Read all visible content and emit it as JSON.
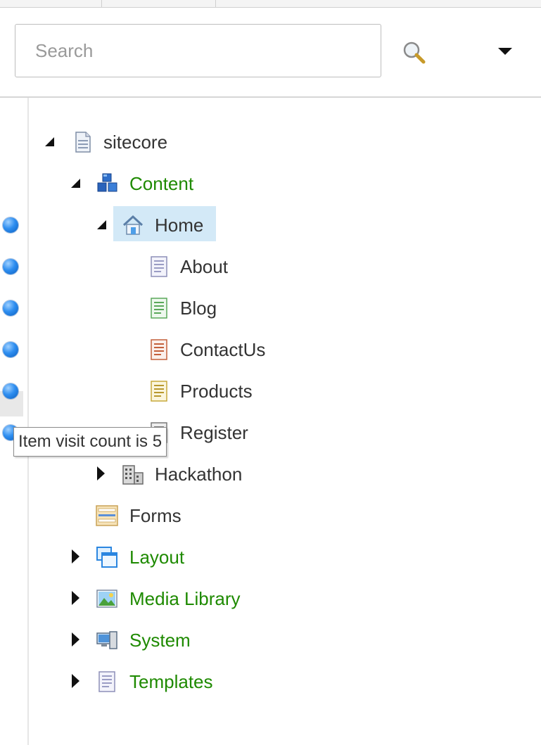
{
  "search": {
    "placeholder": "Search"
  },
  "toolbar": {
    "search_icon": "magnifier-icon",
    "dropdown_icon": "triangle-down-icon"
  },
  "tree": {
    "sitecore": "sitecore",
    "content": "Content",
    "home": "Home",
    "about": "About",
    "blog": "Blog",
    "contactus": "ContactUs",
    "products": "Products",
    "register": "Register",
    "hackathon": "Hackathon",
    "forms": "Forms",
    "layout": "Layout",
    "media_library": "Media Library",
    "system": "System",
    "templates": "Templates"
  },
  "tooltip": {
    "text": "Item visit count is 5"
  },
  "colors": {
    "link_green": "#1e8a00",
    "selection_bg": "#d3e9f7",
    "dot_blue": "#2e8ef0"
  }
}
